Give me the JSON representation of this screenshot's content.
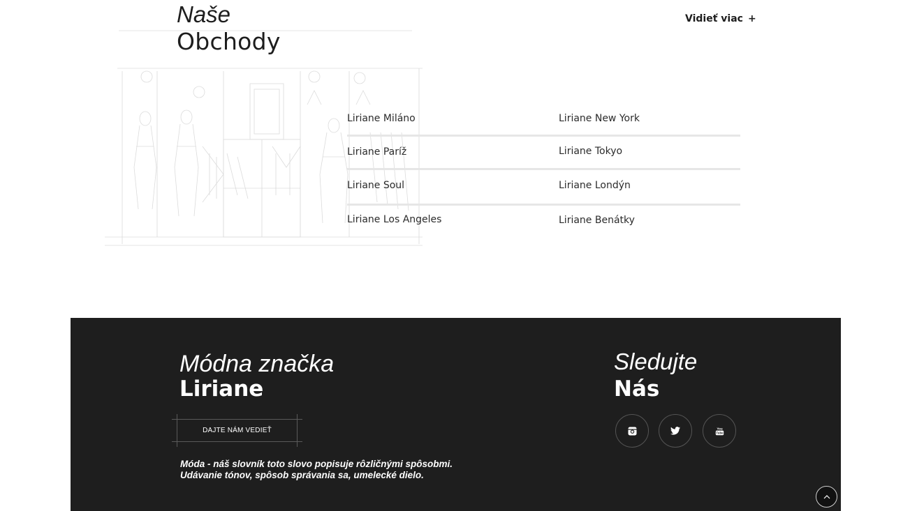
{
  "stores_section": {
    "title_italic": "Naše",
    "title_bold": "Obchody",
    "see_more_label": "Vidieť viac",
    "see_more_icon": "+",
    "stores_left": [
      "Liriane Miláno",
      "Liriane Paríž",
      "Liriane Soul",
      "Liriane Los Angeles"
    ],
    "stores_right": [
      "Liriane New York",
      "Liriane Tokyo",
      "Liriane Londýn",
      "Liriane Benátky"
    ]
  },
  "footer": {
    "brand_italic": "Módna značka",
    "brand_bold": "Liriane",
    "contact_button_label": "DAJTE NÁM VEDIEŤ",
    "tagline": "Móda - náš slovník toto slovo popisuje rôzličnými spôsobmi. Udávanie tónov, spôsob správania sa, umelecké dielo.",
    "follow_italic": "Sledujte",
    "follow_bold": "Nás",
    "social_icons": [
      "instagram-icon",
      "twitter-icon",
      "youtube-icon"
    ],
    "background_color": "#1e1e1e"
  },
  "back_to_top_icon": "chevron-up-icon"
}
